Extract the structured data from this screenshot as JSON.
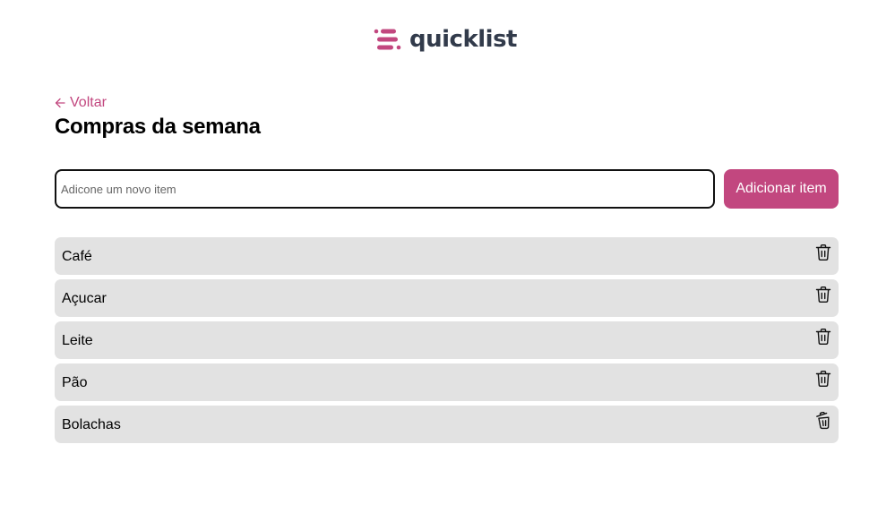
{
  "brand": {
    "name": "quicklist",
    "accent": "#c2477f",
    "text_color": "#323b4b"
  },
  "nav": {
    "back_label": "Voltar",
    "back_icon": "arrow-left-icon"
  },
  "page": {
    "title": "Compras da semana"
  },
  "form": {
    "input_value": "",
    "input_placeholder": "Adicone um novo item",
    "add_label": "Adicionar item"
  },
  "items": [
    {
      "label": "Café",
      "delete_icon": "trash-icon"
    },
    {
      "label": "Açucar",
      "delete_icon": "trash-icon"
    },
    {
      "label": "Leite",
      "delete_icon": "trash-icon"
    },
    {
      "label": "Pão",
      "delete_icon": "trash-icon"
    },
    {
      "label": "Bolachas",
      "delete_icon": "trash-open-icon"
    }
  ]
}
